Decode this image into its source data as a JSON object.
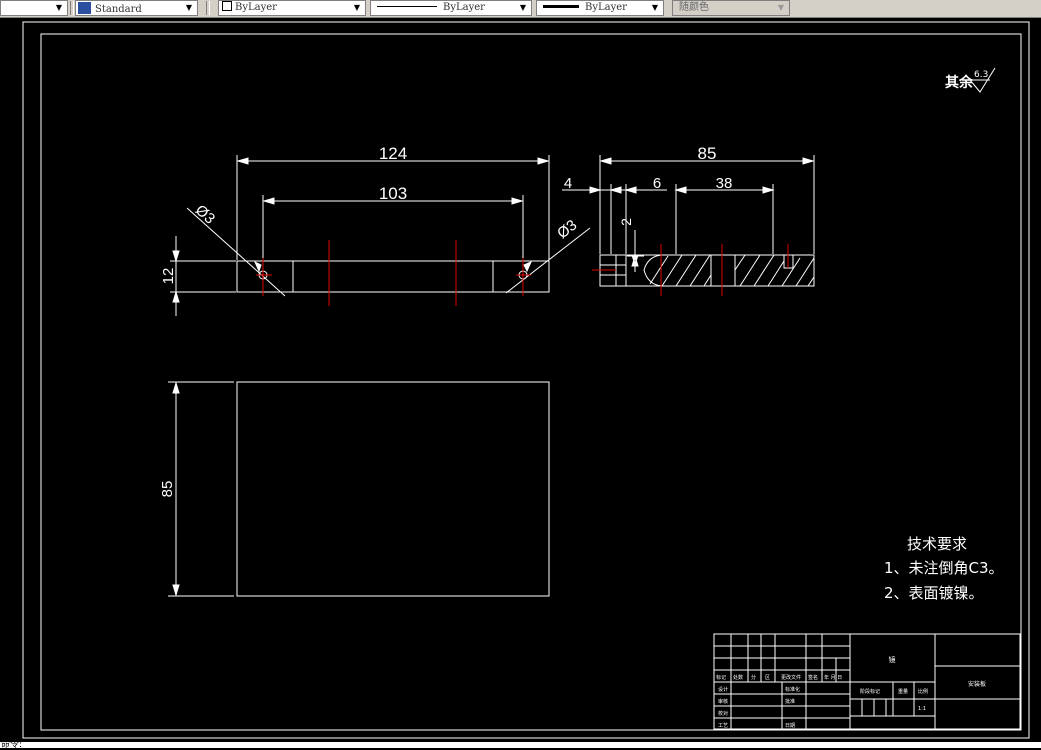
{
  "toolbar": {
    "dim_style": "Standard",
    "layer": "ByLayer",
    "linetype": "ByLayer",
    "lineweight": "ByLayer",
    "plot_style": "随颜色"
  },
  "drawing": {
    "roughness_label": "其余",
    "roughness_value": "6.3",
    "dims": {
      "overall_length": "124",
      "hole_spacing": "103",
      "hole_dia_left": "Ø3",
      "hole_dia_right": "Ø3",
      "height": "12",
      "depth_side": "85",
      "offset_4": "4",
      "offset_6": "6",
      "offset_38": "38",
      "offset_2": "2",
      "width_plan": "85"
    },
    "tech_requirements": {
      "title": "技术要求",
      "items": [
        "1、未注倒角C3。",
        "2、表面镀镍。"
      ]
    },
    "title_block": {
      "part_name": "镜",
      "drawing_name": "安装板",
      "row_headers": [
        "标记",
        "处数",
        "分",
        "区",
        "更改文件",
        "签名",
        "年 月 日"
      ],
      "roles": [
        "设计",
        "审核",
        "校对",
        "工艺"
      ],
      "mid_labels": [
        "标准化",
        "批准",
        "日期"
      ],
      "right_headers": [
        "阶段标记",
        "重量",
        "比例"
      ],
      "scale": "1:1"
    }
  },
  "command_line": {
    "prompt": "命令:"
  }
}
